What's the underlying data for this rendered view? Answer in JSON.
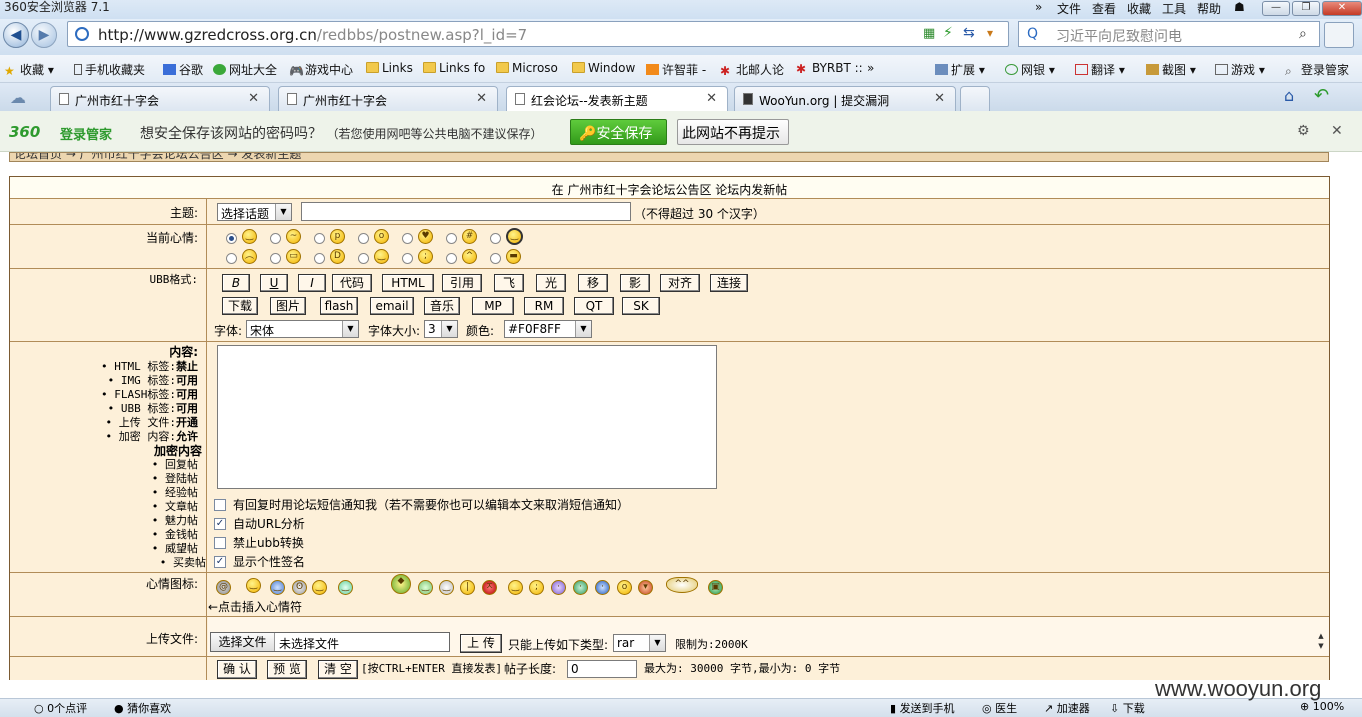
{
  "browser": {
    "title": "360安全浏览器 7.1",
    "menu": [
      "文件",
      "查看",
      "收藏",
      "工具",
      "帮助"
    ],
    "win_buttons": [
      "—",
      "❐",
      "✕"
    ],
    "address": {
      "host": "http://www.gzredcross.org.cn",
      "path": "/redbbs/postnew.asp?l_id=7"
    },
    "search_placeholder": "习近平向尼致慰问电",
    "bookmarks": [
      "收藏",
      "手机收藏夹",
      "谷歌",
      "网址大全",
      "游戏中心",
      "Links",
      "Links fo",
      "Microso",
      "Window",
      "许智菲 -",
      "北邮人论",
      "BYRBT ::",
      "»",
      "扩展",
      "网银",
      "翻译",
      "截图",
      "游戏",
      "登录管家"
    ],
    "tabs": [
      {
        "label": "广州市红十字会",
        "active": false
      },
      {
        "label": "广州市红十字会",
        "active": false
      },
      {
        "label": "红会论坛--发表新主题",
        "active": true
      },
      {
        "label": "WooYun.org | 提交漏洞",
        "active": false
      }
    ]
  },
  "password_bar": {
    "brand": "360",
    "product": "登录管家",
    "question": "想安全保存该网站的密码吗？",
    "note": "（若您使用网吧等公共电脑不建议保存）",
    "save_button": "安全保存",
    "no_button": "此网站不再提示"
  },
  "breadcrumb": "论坛首页 → 广州市红十字会论坛公告区 → 发表新主题",
  "form": {
    "heading": "在 广州市红十字会论坛公告区 论坛内发新帖",
    "subject_label": "主题:",
    "topic_select": "选择话题",
    "subject_hint": "（不得超过 30 个汉字）",
    "mood_label": "当前心情:",
    "ubb_label": "UBB格式:",
    "ubb_row1": [
      "B",
      "U",
      "I",
      "代码",
      "HTML",
      "引用",
      "飞",
      "光",
      "移",
      "影",
      "对齐",
      "连接"
    ],
    "ubb_row2": [
      "下载",
      "图片",
      "flash",
      "email",
      "音乐",
      "MP",
      "RM",
      "QT",
      "SK"
    ],
    "font_label": "字体:",
    "font_value": "宋体",
    "size_label": "字体大小:",
    "size_value": "3",
    "color_label": "颜色:",
    "color_value": "#F0F8FF",
    "content_label": "内容:",
    "rules": [
      {
        "k": "HTML 标签:",
        "v": "禁止"
      },
      {
        "k": "IMG  标签:",
        "v": "可用"
      },
      {
        "k": "FLASH标签:",
        "v": "可用"
      },
      {
        "k": "UBB  标签:",
        "v": "可用"
      },
      {
        "k": "上传 文件:",
        "v": "开通"
      },
      {
        "k": "加密 内容:",
        "v": "允许"
      }
    ],
    "encrypt_title": "加密内容",
    "encrypt_types": [
      "回复帖",
      "登陆帖",
      "经验帖",
      "文章帖",
      "魅力帖",
      "金钱帖",
      "威望帖",
      "买卖帖"
    ],
    "options": [
      {
        "label": "有回复时用论坛短信通知我（若不需要你也可以编辑本文来取消短信通知）",
        "checked": false
      },
      {
        "label": "自动URL分析",
        "checked": true
      },
      {
        "label": "禁止ubb转换",
        "checked": false
      },
      {
        "label": "显示个性签名",
        "checked": true
      }
    ],
    "emote_label": "心情图标:",
    "emote_hint": "←点击插入心情符",
    "upload_label": "上传文件:",
    "choose_file": "选择文件",
    "no_file": "未选择文件",
    "upload_button": "上 传",
    "upload_types_label": "只能上传如下类型:",
    "upload_type": "rar",
    "upload_limit": "限制为:2000K",
    "submit": "确 认",
    "preview": "预 览",
    "clear": "清 空",
    "shortcut": "[按CTRL+ENTER 直接发表]",
    "length_label": "帖子长度:",
    "length_value": "0",
    "length_limits": "最大为: 30000 字节,最小为: 0 字节"
  },
  "watermark": "www.wooyun.org",
  "status": [
    "0个点评",
    "猜你喜欢",
    "发送到手机",
    "医生",
    "加速器",
    "下载",
    "100%"
  ]
}
